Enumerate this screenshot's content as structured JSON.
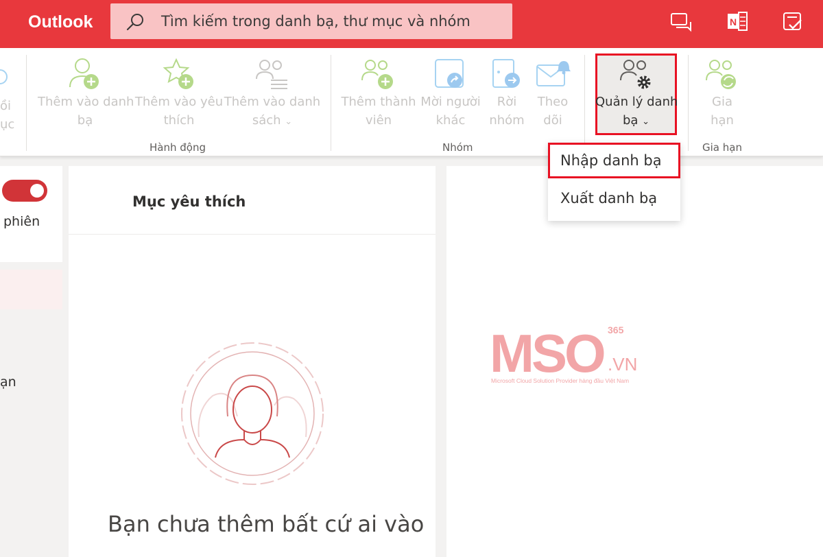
{
  "header": {
    "app_name": "Outlook",
    "search_placeholder": "Tìm kiếm trong danh bạ, thư mục và nhóm",
    "icons": [
      "chat-icon",
      "onenote-icon",
      "todo-icon"
    ]
  },
  "ribbon": {
    "partial_left": [
      "ồi",
      "ục"
    ],
    "groups": [
      {
        "label": "Hành động",
        "buttons": [
          {
            "line1": "Thêm vào danh",
            "line2": "bạ",
            "icon": "add-person-icon"
          },
          {
            "line1": "Thêm vào yêu",
            "line2": "thích",
            "icon": "favorite-add-icon"
          },
          {
            "line1": "Thêm vào danh",
            "line2": "sách",
            "icon": "people-list-icon",
            "has_dropdown": true
          }
        ]
      },
      {
        "label": "Nhóm",
        "buttons": [
          {
            "line1": "Thêm thành",
            "line2": "viên",
            "icon": "add-member-icon"
          },
          {
            "line1": "Mời người",
            "line2": "khác",
            "icon": "invite-icon"
          },
          {
            "line1": "Rời",
            "line2": "nhóm",
            "icon": "leave-group-icon"
          },
          {
            "line1": "Theo",
            "line2": "dõi",
            "icon": "follow-icon"
          },
          {
            "line1": "Quản lý danh",
            "line2": "bạ",
            "icon": "manage-contacts-icon",
            "has_dropdown": true,
            "active": true
          }
        ]
      },
      {
        "label": "Gia hạn",
        "buttons": [
          {
            "line1": "Gia",
            "line2": "hạn",
            "icon": "renew-icon"
          }
        ]
      }
    ]
  },
  "dropdown": {
    "items": [
      {
        "label": "Nhập danh bạ",
        "highlighted": true
      },
      {
        "label": "Xuất danh bạ",
        "highlighted": false
      }
    ]
  },
  "left_pane": {
    "toggle_on": true,
    "partial_text_1": "phiên",
    "partial_text_2": "ạn"
  },
  "middle_pane": {
    "title": "Mục yêu thích",
    "empty_message": "Bạn chưa thêm bất cứ ai vào"
  },
  "watermark": {
    "brand": "MSO",
    "superscript": "365",
    "suffix": ".VN",
    "tagline": "Microsoft Cloud Solution Provider hàng đầu Việt Nam"
  },
  "colors": {
    "header_bg": "#e8383d",
    "search_bg": "#f9c3c4",
    "highlight_border": "#e81123",
    "icon_green": "#6bb700",
    "icon_blue": "#0078d4"
  }
}
